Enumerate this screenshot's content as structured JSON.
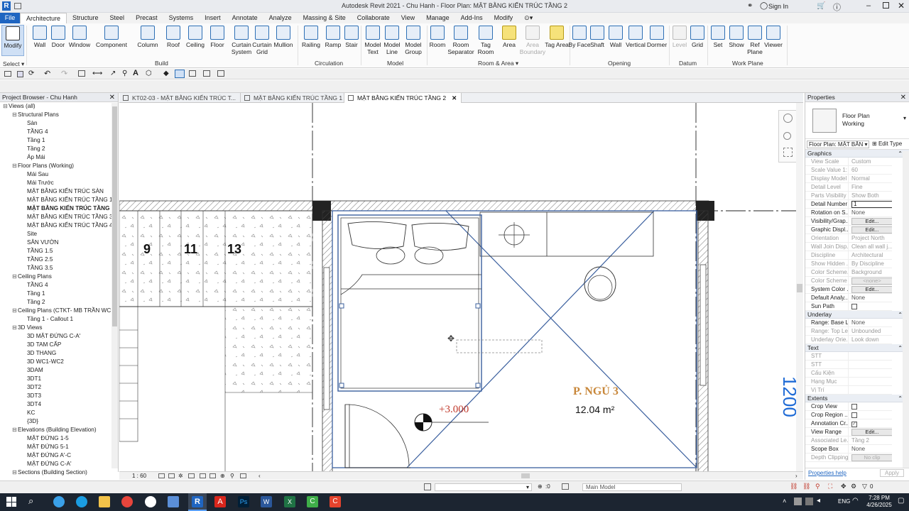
{
  "app": {
    "title": "Autodesk Revit 2021 - Chu Hanh - Floor Plan: MẶT BẰNG KIẾN TRÚC TẦNG 2",
    "sign_in": "Sign In"
  },
  "ribbon_tabs": [
    "File",
    "Architecture",
    "Structure",
    "Steel",
    "Precast",
    "Systems",
    "Insert",
    "Annotate",
    "Analyze",
    "Massing & Site",
    "Collaborate",
    "View",
    "Manage",
    "Add-Ins",
    "Modify"
  ],
  "ribbon_active_tab": "Architecture",
  "tools": {
    "modify": "Modify",
    "wall": "Wall",
    "door": "Door",
    "window": "Window",
    "component": "Component",
    "column": "Column",
    "roof": "Roof",
    "ceiling": "Ceiling",
    "floor": "Floor",
    "curtain_system": "Curtain System",
    "curtain_grid": "Curtain Grid",
    "mullion": "Mullion",
    "railing": "Railing",
    "ramp": "Ramp",
    "stair": "Stair",
    "model_text": "Model Text",
    "model_line": "Model Line",
    "model_group": "Model Group",
    "room": "Room",
    "room_separator": "Room Separator",
    "tag_room": "Tag Room",
    "area": "Area",
    "area_boundary": "Area Boundary",
    "tag_area": "Tag Area",
    "by_face": "By Face",
    "shaft": "Shaft",
    "wall_opening": "Wall",
    "vertical": "Vertical",
    "dormer": "Dormer",
    "level": "Level",
    "grid": "Grid",
    "set": "Set",
    "show": "Show",
    "ref_plane": "Ref Plane",
    "viewer": "Viewer"
  },
  "groups": {
    "select": "Select",
    "build": "Build",
    "circulation": "Circulation",
    "model": "Model",
    "room_area": "Room & Area",
    "opening": "Opening",
    "datum": "Datum",
    "work_plane": "Work Plane"
  },
  "project_browser": {
    "title": "Project Browser - Chu Hanh",
    "items": [
      {
        "t": "Views (all)",
        "lvl": 0,
        "tg": "⊟"
      },
      {
        "t": "Structural Plans",
        "lvl": 1,
        "tg": "⊟"
      },
      {
        "t": "Sàn",
        "lvl": 2
      },
      {
        "t": "TẦNG 4",
        "lvl": 2
      },
      {
        "t": "Tầng 1",
        "lvl": 2
      },
      {
        "t": "Tầng 2",
        "lvl": 2
      },
      {
        "t": "Áp Mái",
        "lvl": 2
      },
      {
        "t": "Floor Plans (Working)",
        "lvl": 1,
        "tg": "⊟"
      },
      {
        "t": "Mái Sau",
        "lvl": 2
      },
      {
        "t": "Mái Trước",
        "lvl": 2
      },
      {
        "t": "MẶT BẰNG KIẾN TRÚC SÀN",
        "lvl": 2
      },
      {
        "t": "MẶT BẰNG KIẾN TRÚC TẦNG 1",
        "lvl": 2
      },
      {
        "t": "MẶT BẰNG KIẾN TRÚC TẦNG 2",
        "lvl": 2,
        "bold": true
      },
      {
        "t": "MẶT BẰNG KIẾN TRÚC TẦNG 3",
        "lvl": 2
      },
      {
        "t": "MẶT BẰNG KIẾN TRÚC TẦNG 4",
        "lvl": 2
      },
      {
        "t": "Site",
        "lvl": 2
      },
      {
        "t": "SÂN VƯỜN",
        "lvl": 2
      },
      {
        "t": "TẦNG 1.5",
        "lvl": 2
      },
      {
        "t": "TẦNG 2.5",
        "lvl": 2
      },
      {
        "t": "TẦNG 3.5",
        "lvl": 2
      },
      {
        "t": "Ceiling Plans",
        "lvl": 1,
        "tg": "⊟"
      },
      {
        "t": "TẦNG 4",
        "lvl": 2
      },
      {
        "t": "Tầng 1",
        "lvl": 2
      },
      {
        "t": "Tầng 2",
        "lvl": 2
      },
      {
        "t": "Ceiling Plans (CTKT- MB TRẦN WC",
        "lvl": 1,
        "tg": "⊟"
      },
      {
        "t": "Tầng 1 - Callout 1",
        "lvl": 2
      },
      {
        "t": "3D Views",
        "lvl": 1,
        "tg": "⊟"
      },
      {
        "t": "3D MẶT ĐỨNG C-A'",
        "lvl": 2
      },
      {
        "t": "3D TAM CẤP",
        "lvl": 2
      },
      {
        "t": "3D THANG",
        "lvl": 2
      },
      {
        "t": "3D WC1-WC2",
        "lvl": 2
      },
      {
        "t": "3DAM",
        "lvl": 2
      },
      {
        "t": "3DT1",
        "lvl": 2
      },
      {
        "t": "3DT2",
        "lvl": 2
      },
      {
        "t": "3DT3",
        "lvl": 2
      },
      {
        "t": "3DT4",
        "lvl": 2
      },
      {
        "t": "KC",
        "lvl": 2
      },
      {
        "t": "{3D}",
        "lvl": 2
      },
      {
        "t": "Elevations (Building Elevation)",
        "lvl": 1,
        "tg": "⊟"
      },
      {
        "t": "MẶT ĐỨNG 1-5",
        "lvl": 2
      },
      {
        "t": "MẶT ĐỨNG 5-1",
        "lvl": 2
      },
      {
        "t": "MẶT ĐỨNG A'-C",
        "lvl": 2
      },
      {
        "t": "MẶT ĐỨNG C-A'",
        "lvl": 2
      },
      {
        "t": "Sections (Building Section)",
        "lvl": 1,
        "tg": "⊟"
      }
    ]
  },
  "doc_tabs": [
    {
      "label": "KT02-03 - MẶT BẰNG KIẾN TRÚC T...",
      "active": false
    },
    {
      "label": "MẶT BẰNG KIẾN TRÚC TẦNG 1",
      "active": false
    },
    {
      "label": "MẶT BẰNG KIẾN TRÚC TẦNG 2",
      "active": true
    }
  ],
  "plan": {
    "stair_numbers": [
      "9",
      "11",
      "13"
    ],
    "room_name": "P. NGỦ 3",
    "room_area": "12.04 m²",
    "level_mark": "+3.000",
    "dim_text": "1200"
  },
  "view_bar": {
    "scale": "1 : 60"
  },
  "properties": {
    "title": "Properties",
    "type_name": "Floor Plan",
    "type_sub": "Working",
    "selector": "Floor Plan: MẶT BẰN",
    "edit_type": "Edit Type",
    "sections": [
      {
        "name": "Graphics",
        "rows": [
          {
            "n": "View Scale",
            "v": "Custom",
            "gray": true
          },
          {
            "n": "Scale Value 1:",
            "v": "60",
            "gray": true
          },
          {
            "n": "Display Model",
            "v": "Normal",
            "gray": true
          },
          {
            "n": "Detail Level",
            "v": "Fine",
            "gray": true
          },
          {
            "n": "Parts Visibility",
            "v": "Show Both",
            "gray": true
          },
          {
            "n": "Detail Number",
            "v": "1",
            "input": true
          },
          {
            "n": "Rotation on S...",
            "v": "None"
          },
          {
            "n": "Visibility/Grap...",
            "v": "Edit...",
            "btn": true
          },
          {
            "n": "Graphic Displ...",
            "v": "Edit...",
            "btn": true
          },
          {
            "n": "Orientation",
            "v": "Project North",
            "gray": true
          },
          {
            "n": "Wall Join Disp...",
            "v": "Clean all wall j...",
            "gray": true
          },
          {
            "n": "Discipline",
            "v": "Architectural",
            "gray": true
          },
          {
            "n": "Show Hidden ...",
            "v": "By Discipline",
            "gray": true
          },
          {
            "n": "Color Scheme...",
            "v": "Background",
            "gray": true
          },
          {
            "n": "Color Scheme",
            "v": "<none>",
            "btn": true,
            "dis": true,
            "gray": true
          },
          {
            "n": "System Color ...",
            "v": "Edit...",
            "btn": true
          },
          {
            "n": "Default Analy...",
            "v": "None"
          },
          {
            "n": "Sun Path",
            "v": "",
            "cb": true
          }
        ]
      },
      {
        "name": "Underlay",
        "rows": [
          {
            "n": "Range: Base L...",
            "v": "None"
          },
          {
            "n": "Range: Top Le...",
            "v": "Unbounded",
            "gray": true
          },
          {
            "n": "Underlay Orie...",
            "v": "Look down",
            "gray": true
          }
        ]
      },
      {
        "name": "Text",
        "rows": [
          {
            "n": "STT",
            "v": "",
            "gray": true
          },
          {
            "n": "STT",
            "v": "",
            "gray": true
          },
          {
            "n": "Cấu Kiện",
            "v": "",
            "gray": true
          },
          {
            "n": "Hạng Mục",
            "v": "",
            "gray": true
          },
          {
            "n": "Vị Trí",
            "v": "",
            "gray": true
          }
        ]
      },
      {
        "name": "Extents",
        "rows": [
          {
            "n": "Crop View",
            "v": "",
            "cb": true
          },
          {
            "n": "Crop Region ...",
            "v": "",
            "cb": true
          },
          {
            "n": "Annotation Cr...",
            "v": "",
            "cb": true,
            "checked": true
          },
          {
            "n": "View Range",
            "v": "Edit...",
            "btn": true
          },
          {
            "n": "Associated Le...",
            "v": "Tầng 2",
            "gray": true
          },
          {
            "n": "Scope Box",
            "v": "None"
          },
          {
            "n": "Depth Clipping",
            "v": "No clip",
            "btn": true,
            "dis": true,
            "gray": true
          }
        ]
      }
    ],
    "help": "Properties help",
    "apply": "Apply"
  },
  "status": {
    "model": "Main Model",
    "zero": ":0",
    "filter": "0"
  },
  "clock": {
    "time": "7:28 PM",
    "date": "4/26/2025",
    "lang": "ENG"
  },
  "colors": {
    "accent": "#1f65c1",
    "room_text": "#c8873a",
    "level_text": "#c0392b",
    "select_blue": "#3a5f9e"
  }
}
